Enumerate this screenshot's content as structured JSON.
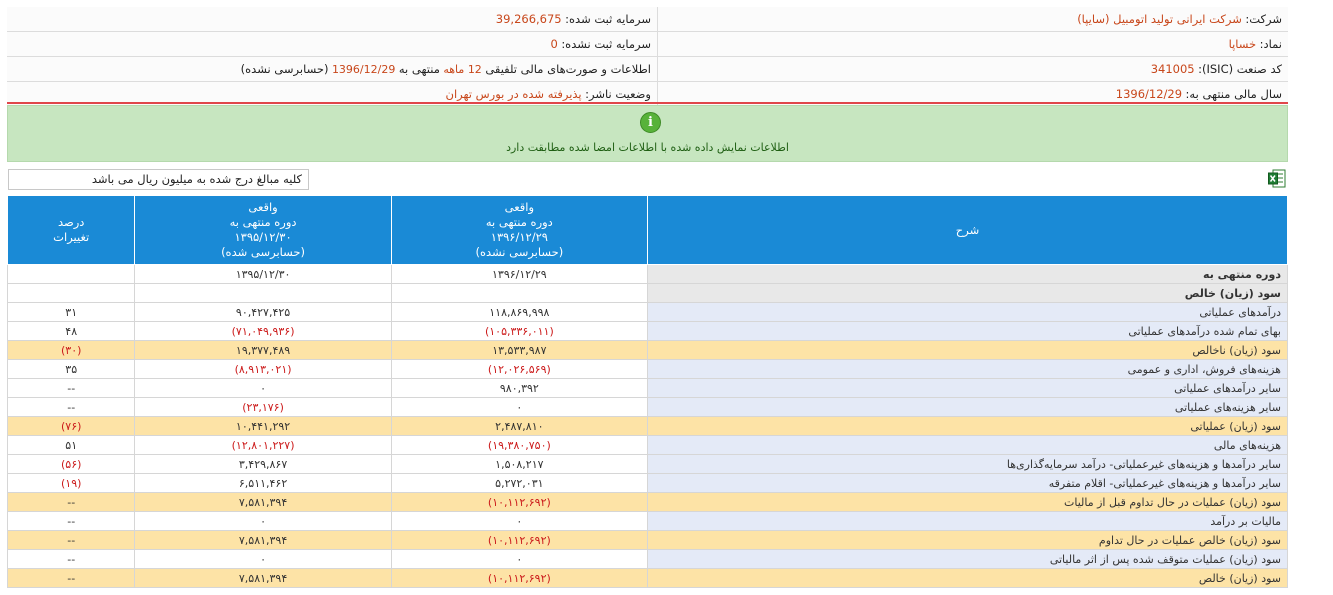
{
  "company": {
    "company_label": "شرکت:",
    "company_value": "شرکت ایرانی تولید اتومبیل (سایپا)",
    "symbol_label": "نماد:",
    "symbol_value": "خساپا",
    "isic_label": "کد صنعت (ISIC):",
    "isic_value": "341005",
    "fiscal_label": "سال مالی منتهی به:",
    "fiscal_value": "1396/12/29",
    "capital_label": "سرمایه ثبت شده:",
    "capital_value": "39,266,675",
    "unreg_label": "سرمایه ثبت نشده:",
    "unreg_value": "0",
    "report_pre": "اطلاعات و صورت‌های مالی تلفیقی",
    "report_months": "12 ماهه",
    "report_mid": "منتهی به",
    "report_date": "1396/12/29",
    "report_status": "(حسابرسی نشده)",
    "publisher_label": "وضعیت ناشر:",
    "publisher_value": "پذیرفته شده در بورس تهران"
  },
  "notice": {
    "icon": "info-icon",
    "message": "اطلاعات نمایش داده شده با اطلاعات امضا شده مطابقت دارد"
  },
  "units_note": "کلیه مبالغ درج شده به میلیون ریال می باشد",
  "excel_icon": "excel-icon",
  "table": {
    "headers": {
      "desc": "شرح",
      "col1_l1": "واقعی",
      "col1_l2": "دوره منتهی به",
      "col1_l3": "۱۳۹۶/۱۲/۲۹",
      "col1_l4": "(حسابرسی نشده)",
      "col2_l1": "واقعی",
      "col2_l2": "دوره منتهی به",
      "col2_l3": "۱۳۹۵/۱۲/۳۰",
      "col2_l4": "(حسابرسی شده)",
      "col3_l1": "درصد",
      "col3_l2": "تغییرات"
    },
    "rows": [
      {
        "desc": "دوره منتهی به",
        "c1": "۱۳۹۶/۱۲/۲۹",
        "c2": "۱۳۹۵/۱۲/۳۰",
        "c3": ""
      },
      {
        "desc": "سود (زیان) خالص",
        "c1": "",
        "c2": "",
        "c3": ""
      },
      {
        "desc": "درآمدهای عملیاتی",
        "c1": "۱۱۸,۸۶۹,۹۹۸",
        "c2": "۹۰,۴۲۷,۴۲۵",
        "c3": "۳۱"
      },
      {
        "desc": "بهای تمام شده درآمدهای عملیاتی",
        "c1": "(۱۰۵,۳۳۶,۰۱۱)",
        "c2": "(۷۱,۰۴۹,۹۳۶)",
        "c3": "۴۸"
      },
      {
        "desc": "سود (زیان) ناخالص",
        "c1": "۱۳,۵۳۳,۹۸۷",
        "c2": "۱۹,۳۷۷,۴۸۹",
        "c3": "(۳۰)"
      },
      {
        "desc": "هزینه‌های فروش، اداری و عمومی",
        "c1": "(۱۲,۰۲۶,۵۶۹)",
        "c2": "(۸,۹۱۳,۰۲۱)",
        "c3": "۳۵"
      },
      {
        "desc": "سایر درآمدهای عملیاتی",
        "c1": "۹۸۰,۳۹۲",
        "c2": "۰",
        "c3": "--"
      },
      {
        "desc": "سایر هزینه‌های عملیاتی",
        "c1": "۰",
        "c2": "(۲۳,۱۷۶)",
        "c3": "--"
      },
      {
        "desc": "سود (زیان) عملیاتی",
        "c1": "۲,۴۸۷,۸۱۰",
        "c2": "۱۰,۴۴۱,۲۹۲",
        "c3": "(۷۶)"
      },
      {
        "desc": "هزینه‌های مالی",
        "c1": "(۱۹,۳۸۰,۷۵۰)",
        "c2": "(۱۲,۸۰۱,۲۲۷)",
        "c3": "۵۱"
      },
      {
        "desc": "سایر درآمدها و هزینه‌های غیرعملیاتی- درآمد سرمایه‌گذاری‌ها",
        "c1": "۱,۵۰۸,۲۱۷",
        "c2": "۳,۴۲۹,۸۶۷",
        "c3": "(۵۶)"
      },
      {
        "desc": "سایر درآمدها و هزینه‌های غیرعملیاتی- اقلام متفرقه",
        "c1": "۵,۲۷۲,۰۳۱",
        "c2": "۶,۵۱۱,۴۶۲",
        "c3": "(۱۹)"
      },
      {
        "desc": "سود (زیان) عملیات در حال تداوم قبل از مالیات",
        "c1": "(۱۰,۱۱۲,۶۹۲)",
        "c2": "۷,۵۸۱,۳۹۴",
        "c3": "--"
      },
      {
        "desc": "مالیات بر درآمد",
        "c1": "۰",
        "c2": "۰",
        "c3": "--"
      },
      {
        "desc": "سود (زیان) خالص عملیات در حال تداوم",
        "c1": "(۱۰,۱۱۲,۶۹۲)",
        "c2": "۷,۵۸۱,۳۹۴",
        "c3": "--"
      },
      {
        "desc": "سود (زیان) عملیات متوقف شده پس از اثر مالیاتی",
        "c1": "۰",
        "c2": "۰",
        "c3": "--"
      },
      {
        "desc": "سود (زیان) خالص",
        "c1": "(۱۰,۱۱۲,۶۹۲)",
        "c2": "۷,۵۸۱,۳۹۴",
        "c3": "--"
      }
    ]
  },
  "colors": {
    "header_blue": "#1a8ad6",
    "highlight_row": "#fde3a6",
    "desc_bg": "#e4eaf7",
    "negative": "#cc1c1c",
    "notice_green": "#c7e6c0",
    "alert_line": "#e0464a",
    "value_orange": "#c8471b"
  }
}
